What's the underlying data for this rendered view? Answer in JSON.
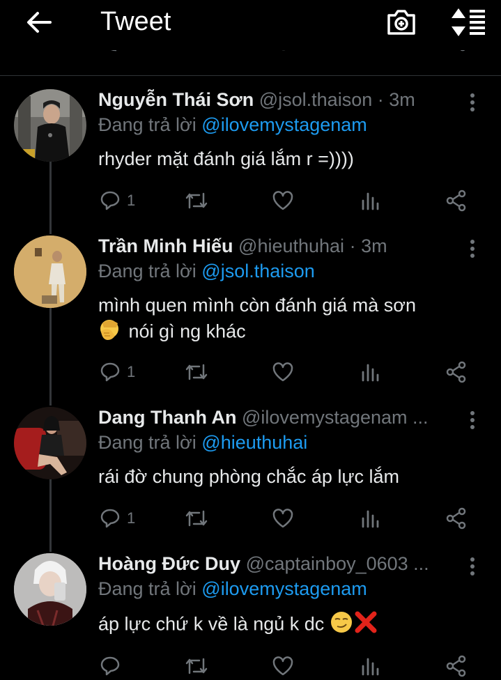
{
  "header": {
    "title": "Tweet"
  },
  "tweets": [
    {
      "name": "Nguyễn Thái Sơn",
      "handle": "@jsol.thaison",
      "time": "· 3m",
      "reply_prefix": "Đang trả lời",
      "reply_to": "@ilovemystagenam",
      "text": "rhyder mặt đánh giá lắm r =))))",
      "reply_count": "1"
    },
    {
      "name": "Trần Minh Hiếu",
      "handle": "@hieuthuhai",
      "time": "· 3m",
      "reply_prefix": "Đang trả lời",
      "reply_to": "@jsol.thaison",
      "text_line1": "mình quen mình còn đánh giá mà sơn",
      "text_line2": "nói gì ng khác",
      "reply_count": "1"
    },
    {
      "name": "Dang Thanh An",
      "handle": "@ilovemystagenam ...",
      "reply_prefix": "Đang trả lời",
      "reply_to": "@hieuthuhai",
      "text": "rái đờ chung phòng chắc áp lực lắm",
      "reply_count": "1"
    },
    {
      "name": "Hoàng Đức Duy",
      "handle": "@captainboy_0603 ...",
      "reply_prefix": "Đang trả lời",
      "reply_to": "@ilovemystagenam",
      "text": "áp lực chứ k về là ngủ k dc"
    }
  ]
}
